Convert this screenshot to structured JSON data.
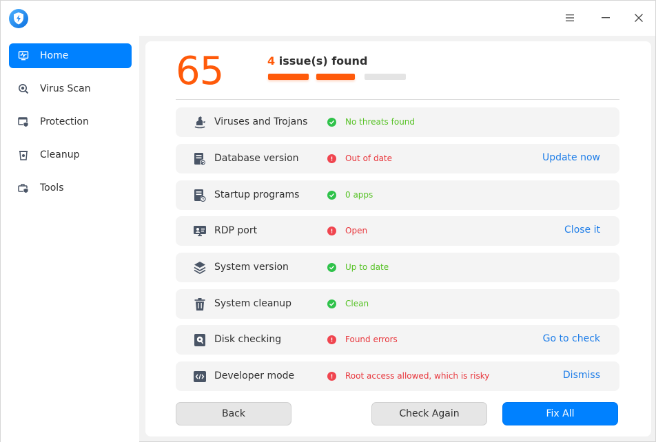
{
  "window": {
    "logo_icon": "shield-lightning-icon",
    "menu_icon": "hamburger-icon",
    "minimize_icon": "minimize-icon",
    "close_icon": "close-icon"
  },
  "sidebar": {
    "items": [
      {
        "label": "Home",
        "icon": "monitor-pulse-icon",
        "active": true
      },
      {
        "label": "Virus Scan",
        "icon": "virus-scan-icon",
        "active": false
      },
      {
        "label": "Protection",
        "icon": "protection-icon",
        "active": false
      },
      {
        "label": "Cleanup",
        "icon": "cleanup-icon",
        "active": false
      },
      {
        "label": "Tools",
        "icon": "tools-icon",
        "active": false
      }
    ]
  },
  "summary": {
    "score": "65",
    "issue_count": "4",
    "issue_text": " issue(s) found",
    "bars_filled": 2,
    "bars_total": 3
  },
  "checks": [
    {
      "label": "Viruses and Trojans",
      "icon": "trojan-horse-icon",
      "status": "ok",
      "status_text": "No threats found",
      "action": ""
    },
    {
      "label": "Database version",
      "icon": "database-update-icon",
      "status": "err",
      "status_text": "Out of date",
      "action": "Update now"
    },
    {
      "label": "Startup programs",
      "icon": "startup-clock-icon",
      "status": "ok",
      "status_text": "0 apps",
      "action": ""
    },
    {
      "label": "RDP port",
      "icon": "remote-desktop-icon",
      "status": "err",
      "status_text": "Open",
      "action": "Close it"
    },
    {
      "label": "System version",
      "icon": "layers-icon",
      "status": "ok",
      "status_text": "Up to date",
      "action": ""
    },
    {
      "label": "System cleanup",
      "icon": "trash-icon",
      "status": "ok",
      "status_text": "Clean",
      "action": ""
    },
    {
      "label": "Disk checking",
      "icon": "disk-check-icon",
      "status": "err",
      "status_text": "Found errors",
      "action": "Go to check"
    },
    {
      "label": "Developer mode",
      "icon": "code-icon",
      "status": "err",
      "status_text": "Root access allowed, which is risky",
      "action": "Dismiss"
    }
  ],
  "buttons": {
    "back": "Back",
    "check_again": "Check Again",
    "fix_all": "Fix All"
  },
  "colors": {
    "accent": "#0081ff",
    "warning_orange": "#ff5a0a",
    "ok_green": "#2fc24a",
    "error_red": "#f0454f",
    "link_blue": "#1f7ee8"
  }
}
